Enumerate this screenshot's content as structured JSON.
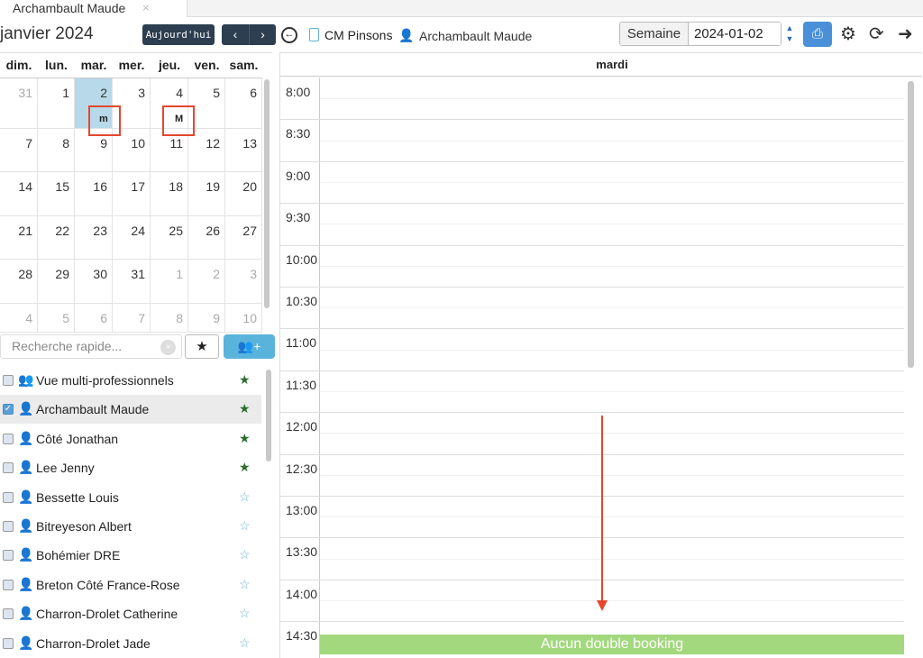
{
  "tab": {
    "title": "Archambault Maude",
    "close": "×"
  },
  "toolbar": {
    "month_title": "janvier 2024",
    "today_label": "Aujourd'hui",
    "prev": "‹",
    "next": "›",
    "clinic_name": "CM Pinsons",
    "professional_name": "Archambault Maude",
    "view_mode": "Semaine",
    "view_date": "2024-01-02"
  },
  "icons": {
    "back": "back-circle-icon",
    "clinic": "clinic-doc-icon",
    "professional": "doctor-icon",
    "print": "print-icon",
    "settings": "gear-icon",
    "refresh": "refresh-icon",
    "logout": "logout-icon"
  },
  "mini_calendar": {
    "days_of_week": [
      "dim.",
      "lun.",
      "mar.",
      "mer.",
      "jeu.",
      "ven.",
      "sam."
    ],
    "weeks": [
      [
        "31",
        "1",
        "2",
        "3",
        "4",
        "5",
        "6"
      ],
      [
        "7",
        "8",
        "9",
        "10",
        "11",
        "12",
        "13"
      ],
      [
        "14",
        "15",
        "16",
        "17",
        "18",
        "19",
        "20"
      ],
      [
        "21",
        "22",
        "23",
        "24",
        "25",
        "26",
        "27"
      ],
      [
        "28",
        "29",
        "30",
        "31",
        "1",
        "2",
        "3"
      ],
      [
        "4",
        "5",
        "6",
        "7",
        "8",
        "9",
        "10"
      ]
    ],
    "markers": {
      "tuesday": "m",
      "thursday": "M"
    }
  },
  "search": {
    "placeholder": "Recherche rapide...",
    "clear": "×",
    "fav": "★",
    "add": "👥+"
  },
  "professionals": [
    {
      "name": "Vue multi-professionnels",
      "checked": false,
      "favorite": true,
      "multi": true
    },
    {
      "name": "Archambault Maude",
      "checked": true,
      "favorite": true,
      "multi": false
    },
    {
      "name": "Côté Jonathan",
      "checked": false,
      "favorite": true,
      "multi": false
    },
    {
      "name": "Lee Jenny",
      "checked": false,
      "favorite": true,
      "multi": false
    },
    {
      "name": "Bessette Louis",
      "checked": false,
      "favorite": false,
      "multi": false
    },
    {
      "name": "Bitreyeson Albert",
      "checked": false,
      "favorite": false,
      "multi": false
    },
    {
      "name": "Bohémier DRE",
      "checked": false,
      "favorite": false,
      "multi": false
    },
    {
      "name": "Breton Côté France-Rose",
      "checked": false,
      "favorite": false,
      "multi": false
    },
    {
      "name": "Charron-Drolet Catherine",
      "checked": false,
      "favorite": false,
      "multi": false
    },
    {
      "name": "Charron-Drolet Jade",
      "checked": false,
      "favorite": false,
      "multi": false
    }
  ],
  "day_view": {
    "day_label": "mardi",
    "times": [
      "8:00",
      "8:30",
      "9:00",
      "9:30",
      "10:00",
      "10:30",
      "11:00",
      "11:30",
      "12:00",
      "12:30",
      "13:00",
      "13:30",
      "14:00",
      "14:30"
    ],
    "status_text": "Aucun double booking"
  },
  "colors": {
    "nav_dark": "#2c3e50",
    "selected_day": "#b7d9ea",
    "status_green": "#a3d87e",
    "annotation_red": "#e4472e",
    "primary_blue": "#4a90d9"
  }
}
